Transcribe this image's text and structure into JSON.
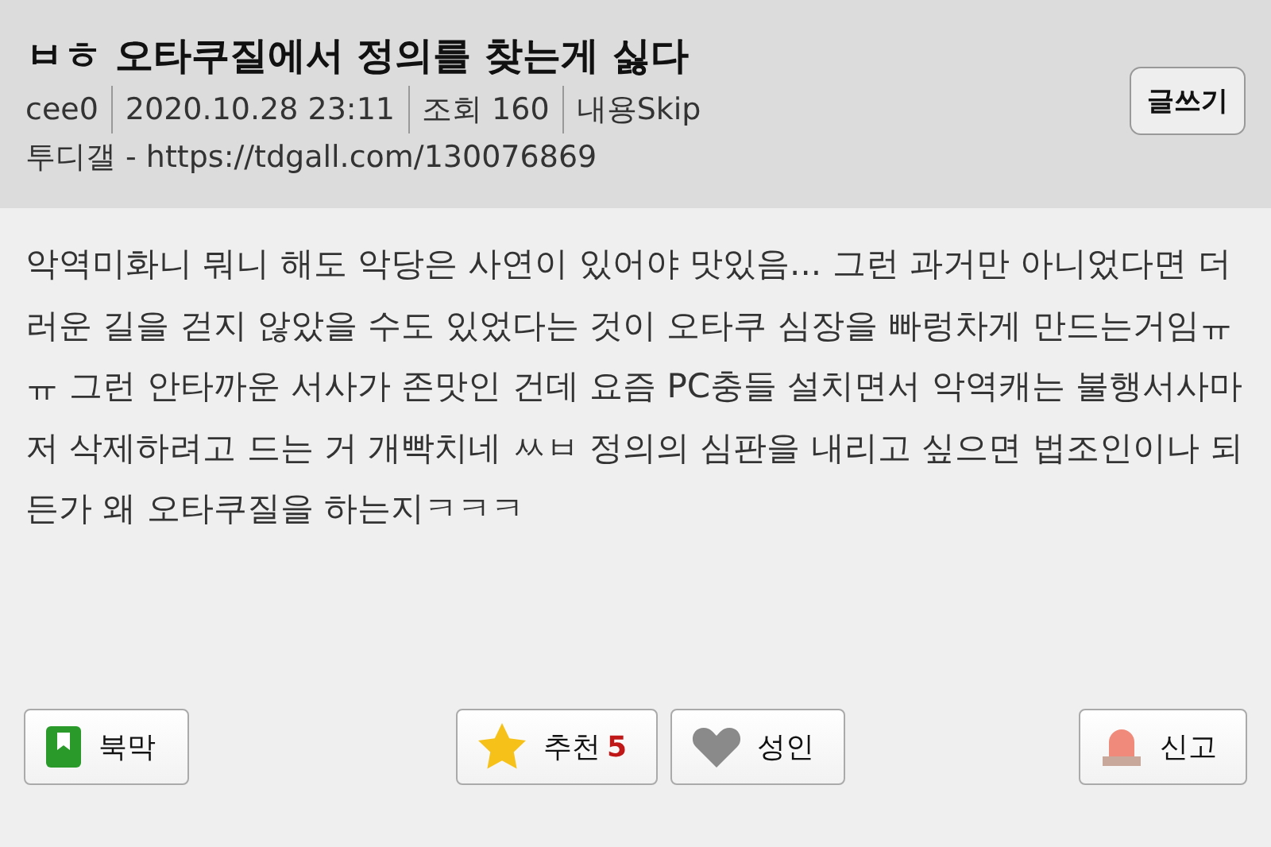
{
  "post": {
    "title": "ㅂㅎ 오타쿠질에서 정의를 찾는게 싫다",
    "meta": [
      "cee0",
      "2020.10.28 23:11",
      "조회 160",
      "내용Skip"
    ],
    "source": "투디갤 - https://tdgall.com/130076869",
    "write_button": "글쓰기"
  },
  "body": "악역미화니 뭐니 해도 악당은 사연이 있어야 맛있음... 그런 과거만 아니었다면 더러운 길을 걷지 않았을 수도 있었다는 것이 오타쿠 심장을 빠렁차게 만드는거임ㅠㅠ 그런 안타까운 서사가 존맛인 건데 요즘 PC충들 설치면서 악역캐는 불행서사마저 삭제하려고 드는 거 개빡치네 ㅆㅂ 정의의 심판을 내리고 싶으면 법조인이나 되든가 왜 오타쿠질을 하는지ㅋㅋㅋ",
  "actions": [
    {
      "kind": "bookmark",
      "label": "북막"
    },
    {
      "kind": "recommend",
      "label": "추천",
      "count": "5"
    },
    {
      "kind": "adult",
      "label": "성인"
    },
    {
      "kind": "report",
      "label": "신고"
    }
  ]
}
